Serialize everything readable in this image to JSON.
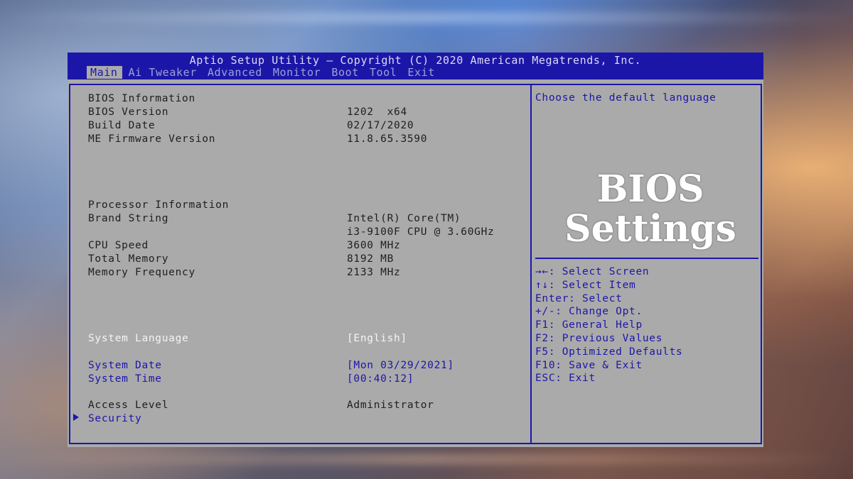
{
  "header": {
    "title": "Aptio Setup Utility – Copyright (C) 2020 American Megatrends, Inc.",
    "tabs": [
      "Main",
      "Ai Tweaker",
      "Advanced",
      "Monitor",
      "Boot",
      "Tool",
      "Exit"
    ],
    "active_tab": "Main"
  },
  "bios_info": {
    "heading": "BIOS Information",
    "version_label": "BIOS Version",
    "version_value": "1202  x64",
    "build_date_label": "Build Date",
    "build_date_value": "02/17/2020",
    "me_label": "ME Firmware Version",
    "me_value": "11.8.65.3590"
  },
  "processor_info": {
    "heading": "Processor Information",
    "brand_label": "Brand String",
    "brand_value_1": "Intel(R) Core(TM)",
    "brand_value_2": "i3-9100F CPU @ 3.60GHz",
    "speed_label": "CPU Speed",
    "speed_value": "3600 MHz",
    "memory_label": "Total Memory",
    "memory_value": "8192 MB",
    "freq_label": "Memory Frequency",
    "freq_value": "2133 MHz"
  },
  "settings": {
    "language_label": "System Language",
    "language_value": "[English]",
    "date_label": "System Date",
    "date_value": "[Mon 03/29/2021]",
    "time_label": "System Time",
    "time_value": "[00:40:12]",
    "access_label": "Access Level",
    "access_value": "Administrator",
    "security_label": "Security"
  },
  "help": {
    "description": "Choose the default language",
    "overlay_line1": "BIOS",
    "overlay_line2": "Settings",
    "keys": [
      "→←: Select Screen",
      "↑↓: Select Item",
      "Enter: Select",
      "+/-: Change Opt.",
      "F1: General Help",
      "F2: Previous Values",
      "F5: Optimized Defaults",
      "F10: Save & Exit",
      "ESC: Exit"
    ]
  },
  "colors": {
    "bios_blue": "#1c16a8",
    "panel_gray": "#aaaaaa",
    "text_dark": "#202020",
    "selected_white": "#f4f4f4"
  }
}
